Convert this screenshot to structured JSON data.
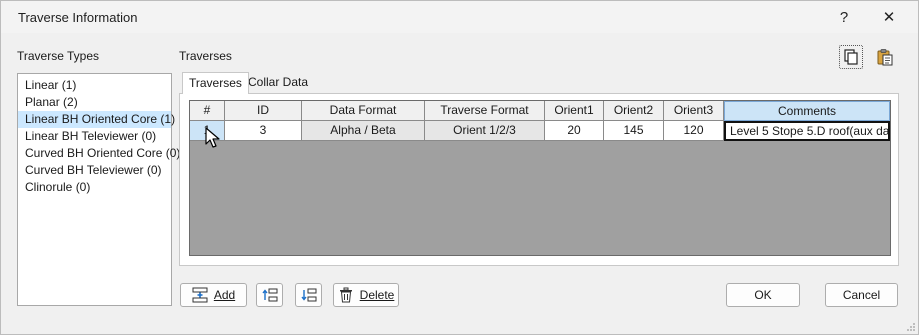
{
  "window": {
    "title": "Traverse Information",
    "help_glyph": "?",
    "close_glyph": "✕"
  },
  "left_panel": {
    "label": "Traverse Types",
    "items": [
      {
        "label": "Linear (1)",
        "selected": false
      },
      {
        "label": "Planar (2)",
        "selected": false
      },
      {
        "label": "Linear BH Oriented Core (1)",
        "selected": true
      },
      {
        "label": "Linear BH Televiewer (0)",
        "selected": false
      },
      {
        "label": "Curved BH Oriented Core (0)",
        "selected": false
      },
      {
        "label": "Curved BH Televiewer (0)",
        "selected": false
      },
      {
        "label": "Clinorule (0)",
        "selected": false
      }
    ]
  },
  "right_panel": {
    "label": "Traverses",
    "tabs": [
      {
        "label": "Traverses",
        "active": true
      },
      {
        "label": "Collar Data",
        "active": false
      }
    ],
    "toolbar_icons": [
      "copy-icon",
      "paste-icon"
    ]
  },
  "grid": {
    "columns": [
      "#",
      "ID",
      "Data Format",
      "Traverse Format",
      "Orient1",
      "Orient2",
      "Orient3",
      "Comments"
    ],
    "rows": [
      [
        "1",
        "3",
        "Alpha / Beta",
        "Orient 1/2/3",
        "20",
        "145",
        "120",
        "Level 5 Stope 5.D roof(aux da"
      ]
    ]
  },
  "buttons": {
    "add": "Add",
    "delete": "Delete",
    "ok": "OK",
    "cancel": "Cancel"
  },
  "colors": {
    "selection": "#cce8ff",
    "grid_background": "#a0a0a0",
    "header_highlight": "#cce4f7"
  }
}
